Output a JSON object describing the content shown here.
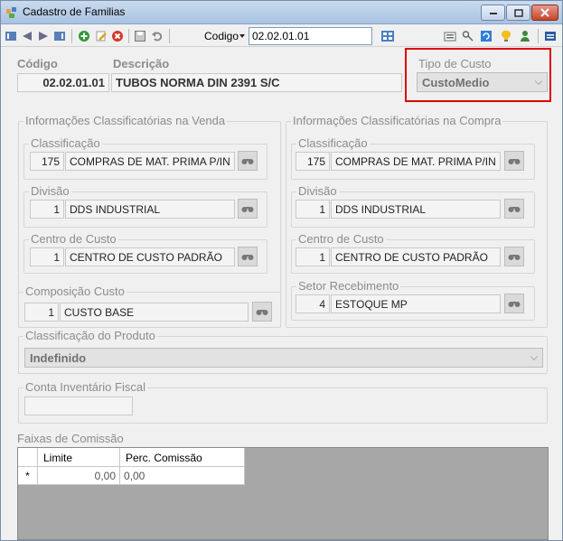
{
  "window": {
    "title": "Cadastro de Familias"
  },
  "toolbar": {
    "search_field_label": "Codigo",
    "search_value": "02.02.01.01"
  },
  "header": {
    "codigo_label": "Código",
    "codigo_value": "02.02.01.01",
    "descricao_label": "Descrição",
    "descricao_value": "TUBOS NORMA DIN 2391 S/C",
    "tipo_custo_label": "Tipo de Custo",
    "tipo_custo_value": "CustoMedio"
  },
  "venda": {
    "group_title": "Informações Classificatórias na Venda",
    "classificacao": {
      "label": "Classificação",
      "code": "175",
      "desc": "COMPRAS DE MAT. PRIMA P/IN"
    },
    "divisao": {
      "label": "Divisão",
      "code": "1",
      "desc": "DDS INDUSTRIAL"
    },
    "centro_custo": {
      "label": "Centro de Custo",
      "code": "1",
      "desc": "CENTRO DE CUSTO PADRÃO"
    },
    "composicao_custo": {
      "label": "Composição Custo",
      "code": "1",
      "desc": "CUSTO BASE"
    }
  },
  "compra": {
    "group_title": "Informações Classificatórias na Compra",
    "classificacao": {
      "label": "Classificação",
      "code": "175",
      "desc": "COMPRAS DE MAT. PRIMA P/IN"
    },
    "divisao": {
      "label": "Divisão",
      "code": "1",
      "desc": "DDS INDUSTRIAL"
    },
    "centro_custo": {
      "label": "Centro de Custo",
      "code": "1",
      "desc": "CENTRO DE CUSTO PADRÃO"
    },
    "setor_recebimento": {
      "label": "Setor Recebimento",
      "code": "4",
      "desc": "ESTOQUE MP"
    }
  },
  "classificacao_produto": {
    "label": "Classificação do Produto",
    "value": "Indefinido"
  },
  "conta_inventario": {
    "label": "Conta Inventário Fiscal",
    "value": ""
  },
  "comissao": {
    "label": "Faixas de Comissão",
    "columns": [
      "Limite",
      "Perc. Comissão"
    ],
    "rows": [
      {
        "marker": "*",
        "limite": "0,00",
        "perc": "0,00"
      }
    ]
  }
}
